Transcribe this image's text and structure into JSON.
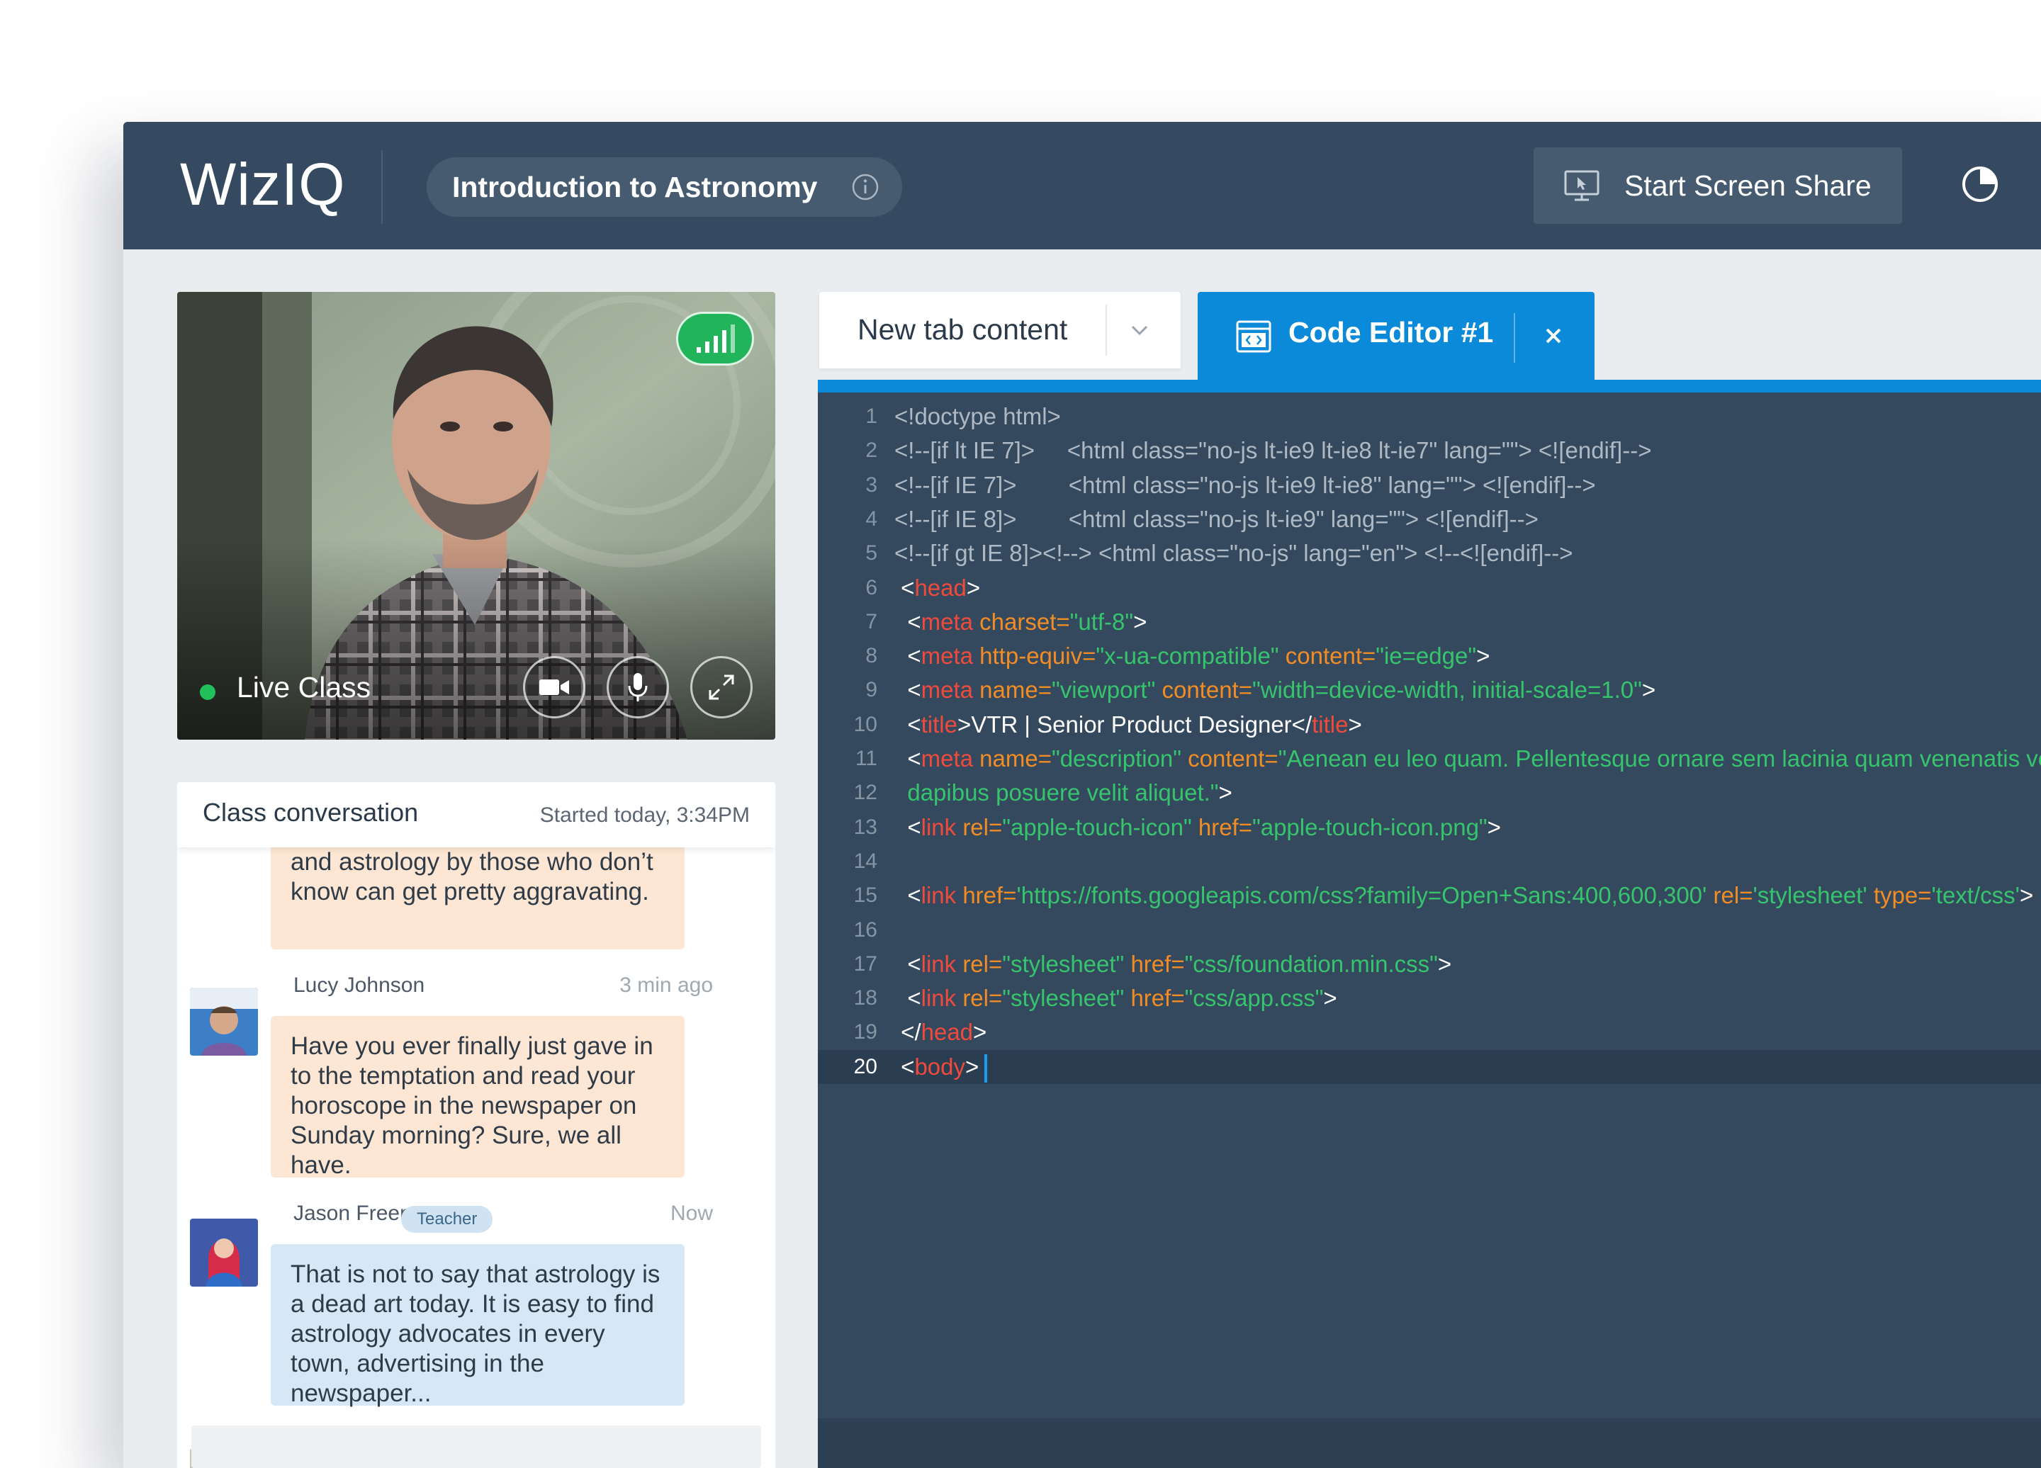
{
  "header": {
    "logo": "WizIQ",
    "class_title": "Introduction to Astronomy",
    "screen_share_label": "Start Screen Share"
  },
  "video": {
    "live_label": "Live Class",
    "status": "live",
    "signal_bars": 4
  },
  "chat": {
    "title": "Class conversation",
    "started": "Started today, 3:34PM",
    "messages": [
      {
        "text": "and astrology by those who don’t know can get pretty aggravating.",
        "style": "peach"
      },
      {
        "name": "Lucy Johnson",
        "time": "3 min ago",
        "text": "Have you ever finally just gave in to the temptation and read your horoscope in the newspaper on Sunday morning? Sure, we all have.",
        "style": "peach"
      },
      {
        "name": "Jason Freeman",
        "role": "Teacher",
        "time": "Now",
        "text": "That is not to say that astrology is a dead art today. It is easy to find astrology advocates in every town, advertising in the newspaper...",
        "style": "blue"
      }
    ]
  },
  "tabs": {
    "new_tab_label": "New tab content",
    "code_tab_label": "Code Editor #1"
  },
  "editor": {
    "active_line": 20,
    "lines": [
      {
        "n": "1",
        "segs": [
          [
            "gray",
            "<!doctype html>"
          ]
        ]
      },
      {
        "n": "2",
        "segs": [
          [
            "gray",
            "<!--[if lt IE 7]>     <html class=\"no-js lt-ie9 lt-ie8 lt-ie7\" lang=\"\"> <![endif]-->"
          ]
        ]
      },
      {
        "n": "3",
        "segs": [
          [
            "gray",
            "<!--[if IE 7]>        <html class=\"no-js lt-ie9 lt-ie8\" lang=\"\"> <![endif]-->"
          ]
        ]
      },
      {
        "n": "4",
        "segs": [
          [
            "gray",
            "<!--[if IE 8]>        <html class=\"no-js lt-ie9\" lang=\"\"> <![endif]-->"
          ]
        ]
      },
      {
        "n": "5",
        "segs": [
          [
            "gray",
            "<!--[if gt IE 8]><!--> <html class=\"no-js\" lang=\"en\"> <!--<![endif]-->"
          ]
        ]
      },
      {
        "n": "6",
        "segs": [
          [
            "white",
            " <"
          ],
          [
            "red",
            "head"
          ],
          [
            "white",
            ">"
          ]
        ]
      },
      {
        "n": "7",
        "segs": [
          [
            "white",
            "  <"
          ],
          [
            "red",
            "meta"
          ],
          [
            "white",
            " "
          ],
          [
            "orange",
            "charset="
          ],
          [
            "green",
            "\"utf-8\""
          ],
          [
            "white",
            ">"
          ]
        ]
      },
      {
        "n": "8",
        "segs": [
          [
            "white",
            "  <"
          ],
          [
            "red",
            "meta"
          ],
          [
            "white",
            " "
          ],
          [
            "orange",
            "http-equiv="
          ],
          [
            "green",
            "\"x-ua-compatible\""
          ],
          [
            "white",
            " "
          ],
          [
            "orange",
            "content="
          ],
          [
            "green",
            "\"ie=edge\""
          ],
          [
            "white",
            ">"
          ]
        ]
      },
      {
        "n": "9",
        "segs": [
          [
            "white",
            "  <"
          ],
          [
            "red",
            "meta"
          ],
          [
            "white",
            " "
          ],
          [
            "orange",
            "name="
          ],
          [
            "green",
            "\"viewport\""
          ],
          [
            "white",
            " "
          ],
          [
            "orange",
            "content="
          ],
          [
            "green",
            "\"width=device-width, initial-scale=1.0\""
          ],
          [
            "white",
            ">"
          ]
        ]
      },
      {
        "n": "10",
        "segs": [
          [
            "white",
            "  <"
          ],
          [
            "red",
            "title"
          ],
          [
            "white",
            ">VTR | Senior Product Designer</"
          ],
          [
            "red",
            "title"
          ],
          [
            "white",
            ">"
          ]
        ]
      },
      {
        "n": "11",
        "segs": [
          [
            "white",
            "  <"
          ],
          [
            "red",
            "meta"
          ],
          [
            "white",
            " "
          ],
          [
            "orange",
            "name="
          ],
          [
            "green",
            "\"description\""
          ],
          [
            "white",
            " "
          ],
          [
            "orange",
            "content="
          ],
          [
            "green",
            "\"Aenean eu leo quam. Pellentesque ornare sem lacinia quam venenatis vestibulum."
          ]
        ]
      },
      {
        "n": "12",
        "segs": [
          [
            "green",
            "  dapibus posuere velit aliquet.\""
          ],
          [
            "white",
            ">"
          ]
        ]
      },
      {
        "n": "13",
        "segs": [
          [
            "white",
            "  <"
          ],
          [
            "red",
            "link"
          ],
          [
            "white",
            " "
          ],
          [
            "orange",
            "rel="
          ],
          [
            "green",
            "\"apple-touch-icon\""
          ],
          [
            "white",
            " "
          ],
          [
            "orange",
            "href="
          ],
          [
            "green",
            "\"apple-touch-icon.png\""
          ],
          [
            "white",
            ">"
          ]
        ]
      },
      {
        "n": "14",
        "segs": []
      },
      {
        "n": "15",
        "segs": [
          [
            "white",
            "  <"
          ],
          [
            "red",
            "link"
          ],
          [
            "white",
            " "
          ],
          [
            "orange",
            "href="
          ],
          [
            "green",
            "'https://fonts.googleapis.com/css?family=Open+Sans:400,600,300'"
          ],
          [
            "white",
            " "
          ],
          [
            "orange",
            "rel="
          ],
          [
            "green",
            "'stylesheet'"
          ],
          [
            "white",
            " "
          ],
          [
            "orange",
            "type="
          ],
          [
            "green",
            "'text/css'"
          ],
          [
            "white",
            ">"
          ]
        ]
      },
      {
        "n": "16",
        "segs": []
      },
      {
        "n": "17",
        "segs": [
          [
            "white",
            "  <"
          ],
          [
            "red",
            "link"
          ],
          [
            "white",
            " "
          ],
          [
            "orange",
            "rel="
          ],
          [
            "green",
            "\"stylesheet\""
          ],
          [
            "white",
            " "
          ],
          [
            "orange",
            "href="
          ],
          [
            "green",
            "\"css/foundation.min.css\""
          ],
          [
            "white",
            ">"
          ]
        ]
      },
      {
        "n": "18",
        "segs": [
          [
            "white",
            "  <"
          ],
          [
            "red",
            "link"
          ],
          [
            "white",
            " "
          ],
          [
            "orange",
            "rel="
          ],
          [
            "green",
            "\"stylesheet\""
          ],
          [
            "white",
            " "
          ],
          [
            "orange",
            "href="
          ],
          [
            "green",
            "\"css/app.css\""
          ],
          [
            "white",
            ">"
          ]
        ]
      },
      {
        "n": "19",
        "segs": [
          [
            "white",
            " </"
          ],
          [
            "red",
            "head"
          ],
          [
            "white",
            ">"
          ]
        ]
      },
      {
        "n": "20",
        "segs": [
          [
            "white",
            " <"
          ],
          [
            "red",
            "body"
          ],
          [
            "white",
            ">"
          ]
        ]
      }
    ]
  },
  "colors": {
    "topbar": "#354a60",
    "accent_blue": "#0a8ad8",
    "editor_bg": "#34495e",
    "live_green": "#21c05b",
    "bubble_peach": "#fde7d4",
    "bubble_blue": "#d6e8f6"
  }
}
